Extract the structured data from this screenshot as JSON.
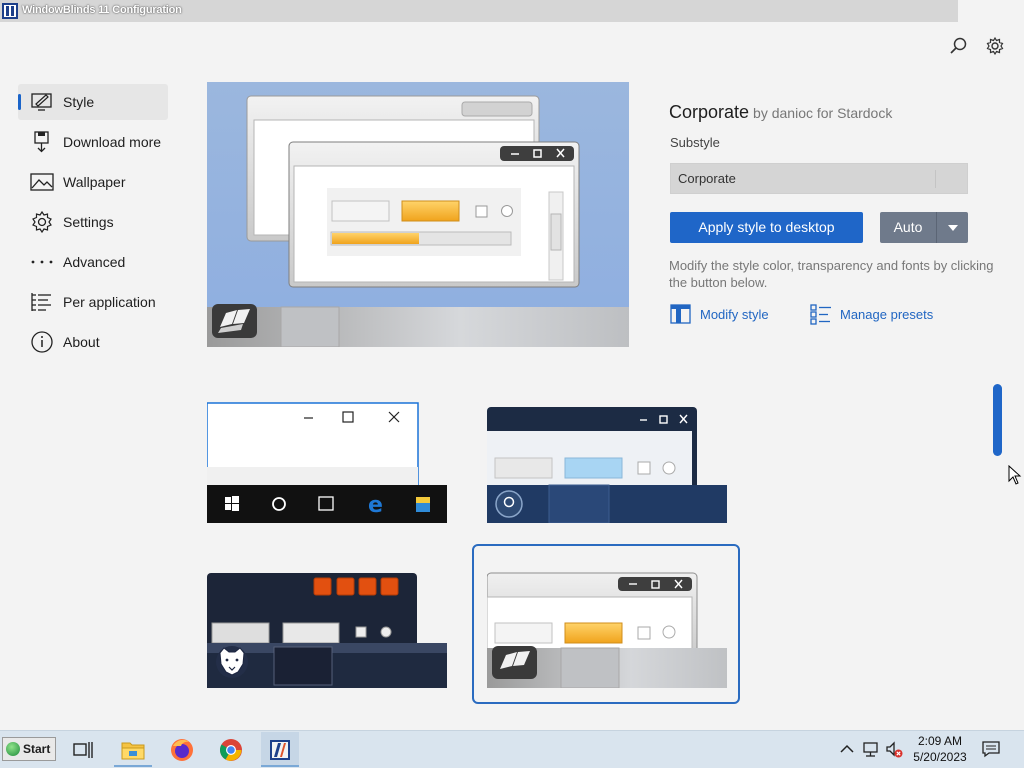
{
  "window": {
    "title": "WindowBlinds 11 Configuration"
  },
  "topbar": {
    "search_icon": "search-icon",
    "settings_icon": "gear-icon"
  },
  "nav": {
    "active": "Style",
    "items": [
      {
        "label": "Style",
        "icon": "style-pen-icon"
      },
      {
        "label": "Download more",
        "icon": "download-icon"
      },
      {
        "label": "Wallpaper",
        "icon": "image-icon"
      },
      {
        "label": "Settings",
        "icon": "gear-icon"
      },
      {
        "label": "Advanced",
        "icon": "ellipsis-icon"
      },
      {
        "label": "Per application",
        "icon": "list-icon"
      },
      {
        "label": "About",
        "icon": "info-icon"
      }
    ]
  },
  "style": {
    "name": "Corporate",
    "author": "by danioc for Stardock",
    "substyle_label": "Substyle",
    "substyle_value": "Corporate",
    "apply_label": "Apply style to desktop",
    "auto_label": "Auto",
    "description": "Modify the style color, transparency and fonts by clicking the button below.",
    "modify_label": "Modify style",
    "presets_label": "Manage presets"
  },
  "thumbnails": [
    "Windows 10 style",
    "Dark blue style",
    "Bears style",
    "Corporate style"
  ],
  "selected_thumbnail": "Corporate style",
  "taskbar": {
    "start_label": "Start",
    "apps": [
      "task-view-icon",
      "file-explorer-icon",
      "firefox-icon",
      "chrome-icon",
      "windowblinds-icon"
    ],
    "time": "2:09 AM",
    "date": "5/20/2023"
  },
  "colors": {
    "accent": "#1f66c8",
    "auto_button": "#6f7a8b",
    "taskbar": "#d9e4ee"
  }
}
